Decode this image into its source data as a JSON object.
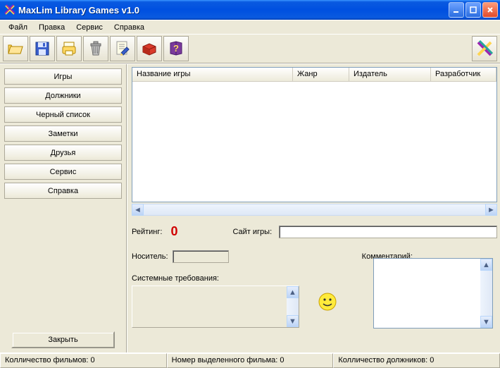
{
  "window": {
    "title": "MaxLim Library Games v1.0"
  },
  "menu": {
    "file": "Файл",
    "edit": "Правка",
    "service": "Сервис",
    "help": "Справка"
  },
  "toolbar": {
    "open": "open",
    "save": "save",
    "print": "print",
    "delete": "delete",
    "edit": "edit",
    "box": "box",
    "help": "help",
    "logo": "logo"
  },
  "sidebar": {
    "items": [
      {
        "label": "Игры"
      },
      {
        "label": "Должники"
      },
      {
        "label": "Черный список"
      },
      {
        "label": "Заметки"
      },
      {
        "label": "Друзья"
      },
      {
        "label": "Сервис"
      },
      {
        "label": "Справка"
      }
    ],
    "close": "Закрыть"
  },
  "table": {
    "columns": {
      "name": "Название игры",
      "genre": "Жанр",
      "publisher": "Издатель",
      "developer": "Разработчик"
    },
    "rows": []
  },
  "details": {
    "rating_label": "Рейтинг:",
    "rating_value": "0",
    "site_label": "Сайт игры:",
    "site_value": "",
    "media_label": "Носитель:",
    "media_value": "",
    "sysreq_label": "Системные требования:",
    "sysreq_value": "",
    "comment_label": "Комментарий:",
    "comment_value": ""
  },
  "status": {
    "films_count": "Колличество фильмов: 0",
    "selected_film": "Номер выделенного фильма: 0",
    "debtors_count": "Колличество должников: 0"
  }
}
